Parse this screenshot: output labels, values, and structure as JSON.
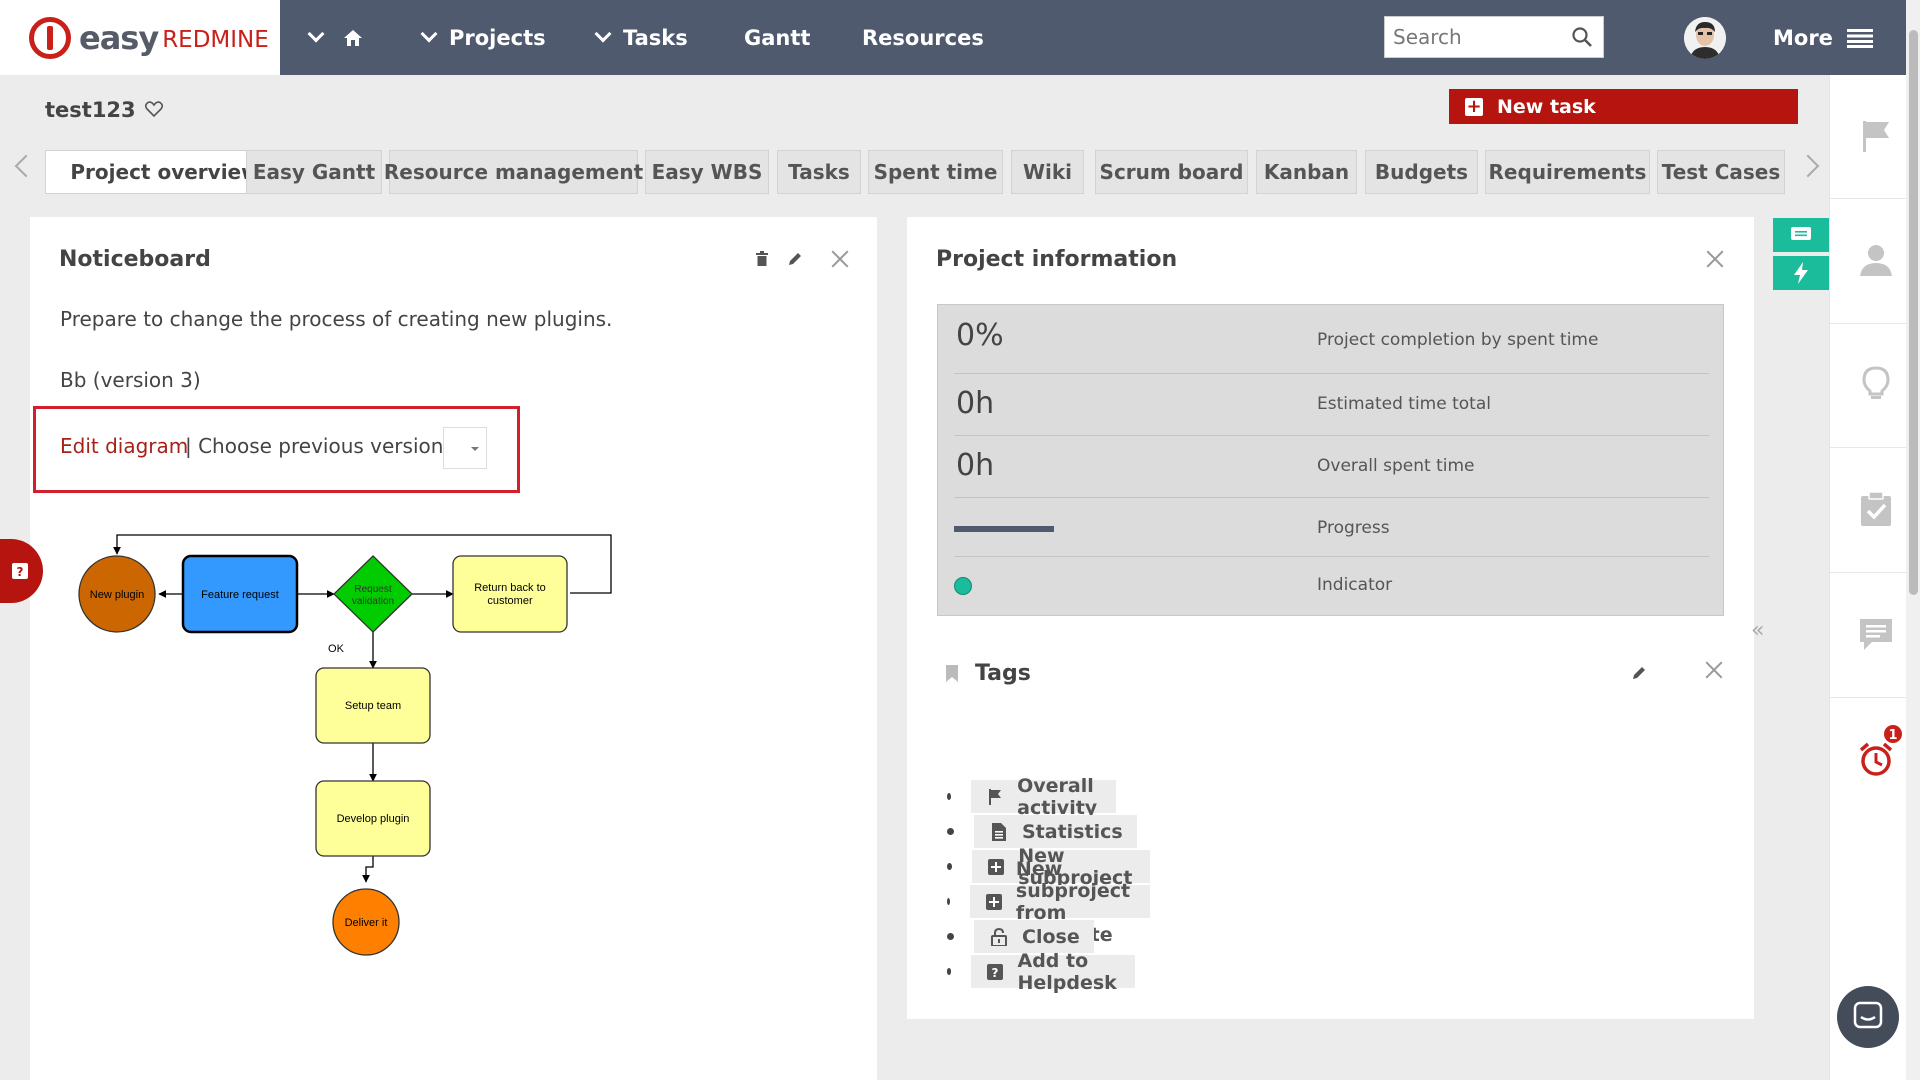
{
  "app": {
    "logo_text_bold": "easy",
    "logo_text_light": "REDMINE"
  },
  "nav": {
    "projects": "Projects",
    "tasks": "Tasks",
    "gantt": "Gantt",
    "resources": "Resources",
    "more": "More",
    "search_placeholder": "Search"
  },
  "project": {
    "title": "test123",
    "new_task": "New task"
  },
  "tabs": [
    {
      "label": "Project overview",
      "active": true
    },
    {
      "label": "Easy Gantt"
    },
    {
      "label": "Resource management"
    },
    {
      "label": "Easy WBS"
    },
    {
      "label": "Tasks"
    },
    {
      "label": "Spent time"
    },
    {
      "label": "Wiki"
    },
    {
      "label": "Scrum board"
    },
    {
      "label": "Kanban"
    },
    {
      "label": "Budgets"
    },
    {
      "label": "Requirements"
    },
    {
      "label": "Test Cases"
    }
  ],
  "noticeboard": {
    "title": "Noticeboard",
    "text": "Prepare to change the process of creating new plugins.",
    "version": "Bb (version 3)",
    "edit_diagram": "Edit diagram",
    "choose_previous": "| Choose previous version:"
  },
  "diagram": {
    "nodes": {
      "new_plugin": "New plugin",
      "feature_request": "Feature request",
      "request_validation_1": "Request",
      "request_validation_2": "validation",
      "return_back_1": "Return back to",
      "return_back_2": "customer",
      "ok": "OK",
      "setup_team": "Setup team",
      "develop_plugin": "Develop plugin",
      "deliver_it": "Deliver it"
    },
    "colors": {
      "new_plugin": "#cc6600",
      "feature_request": "#3399ff",
      "validation": "#00cc00",
      "yellow": "#ffff99",
      "deliver": "#ff8000"
    }
  },
  "project_info": {
    "title": "Project information",
    "rows": [
      {
        "value": "0%",
        "label": "Project completion by spent time"
      },
      {
        "value": "0h",
        "label": "Estimated time total"
      },
      {
        "value": "0h",
        "label": "Overall spent time"
      },
      {
        "value": "",
        "label": "Progress"
      },
      {
        "value": "",
        "label": "Indicator"
      }
    ],
    "indicator_color": "#1abc9c"
  },
  "tags": {
    "title": "Tags",
    "items": [
      {
        "label": "Overall activity",
        "icon": "flag-icon"
      },
      {
        "label": "Statistics",
        "icon": "document-icon"
      },
      {
        "label": "New subproject",
        "icon": "plus-square-icon"
      },
      {
        "label": "New subproject from template",
        "icon": "plus-square-icon"
      },
      {
        "label": "Close",
        "icon": "lock-icon"
      },
      {
        "label": "Add to Helpdesk",
        "icon": "question-square-icon"
      }
    ]
  },
  "sidebar": {
    "notification_count": "1"
  },
  "colors": {
    "topbar": "#505a6f",
    "brand_red": "#b5140f",
    "teal": "#1abc9c"
  }
}
